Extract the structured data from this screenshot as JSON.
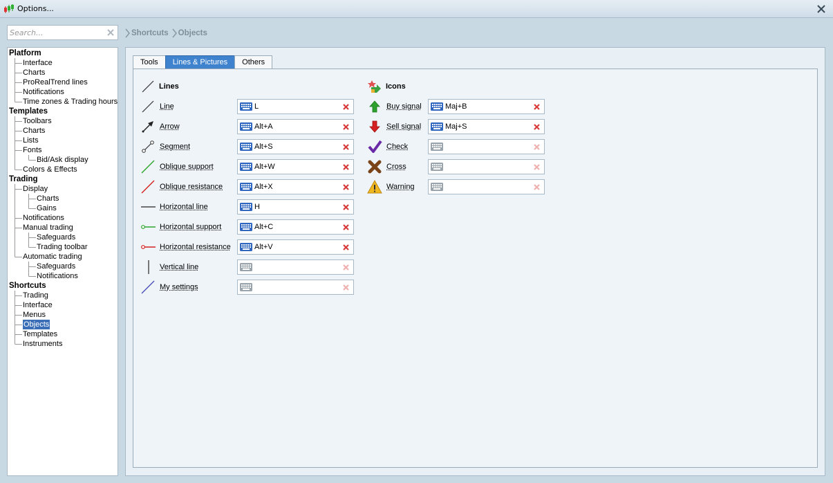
{
  "window": {
    "title": "Options..."
  },
  "search": {
    "placeholder": "Search..."
  },
  "breadcrumb": [
    "Shortcuts",
    "Objects"
  ],
  "tree": [
    {
      "label": "Platform",
      "level": 0
    },
    {
      "label": "Interface",
      "level": 1
    },
    {
      "label": "Charts",
      "level": 1
    },
    {
      "label": "ProRealTrend lines",
      "level": 1
    },
    {
      "label": "Notifications",
      "level": 1
    },
    {
      "label": "Time zones & Trading hours",
      "level": 1
    },
    {
      "label": "Templates",
      "level": 0
    },
    {
      "label": "Toolbars",
      "level": 1
    },
    {
      "label": "Charts",
      "level": 1
    },
    {
      "label": "Lists",
      "level": 1
    },
    {
      "label": "Fonts",
      "level": 1
    },
    {
      "label": "Bid/Ask display",
      "level": 2
    },
    {
      "label": "Colors & Effects",
      "level": 1
    },
    {
      "label": "Trading",
      "level": 0
    },
    {
      "label": "Display",
      "level": 1
    },
    {
      "label": "Charts",
      "level": 2
    },
    {
      "label": "Gains",
      "level": 2
    },
    {
      "label": "Notifications",
      "level": 1
    },
    {
      "label": "Manual trading",
      "level": 1
    },
    {
      "label": "Safeguards",
      "level": 2
    },
    {
      "label": "Trading toolbar",
      "level": 2
    },
    {
      "label": "Automatic trading",
      "level": 1
    },
    {
      "label": "Safeguards",
      "level": 2
    },
    {
      "label": "Notifications",
      "level": 2
    },
    {
      "label": "Shortcuts",
      "level": 0
    },
    {
      "label": "Trading",
      "level": 1
    },
    {
      "label": "Interface",
      "level": 1
    },
    {
      "label": "Menus",
      "level": 1
    },
    {
      "label": "Objects",
      "level": 1,
      "selected": true
    },
    {
      "label": "Templates",
      "level": 1
    },
    {
      "label": "Instruments",
      "level": 1
    }
  ],
  "tabs": [
    {
      "label": "Tools",
      "active": false
    },
    {
      "label": "Lines & Pictures",
      "active": true
    },
    {
      "label": "Others",
      "active": false
    }
  ],
  "lines": {
    "title": "Lines",
    "rows": [
      {
        "label": "Line",
        "shortcut": "L",
        "icon": "line-icon"
      },
      {
        "label": "Arrow",
        "shortcut": "Alt+A",
        "icon": "arrow-icon"
      },
      {
        "label": "Segment",
        "shortcut": "Alt+S",
        "icon": "segment-icon"
      },
      {
        "label": "Oblique support",
        "shortcut": "Alt+W",
        "icon": "oblique-support-icon"
      },
      {
        "label": "Oblique resistance",
        "shortcut": "Alt+X",
        "icon": "oblique-resistance-icon"
      },
      {
        "label": "Horizontal line",
        "shortcut": "H",
        "icon": "horizontal-line-icon"
      },
      {
        "label": "Horizontal support",
        "shortcut": "Alt+C",
        "icon": "horizontal-support-icon"
      },
      {
        "label": "Horizontal resistance",
        "shortcut": "Alt+V",
        "icon": "horizontal-resistance-icon"
      },
      {
        "label": "Vertical line",
        "shortcut": "",
        "icon": "vertical-line-icon"
      },
      {
        "label": "My settings",
        "shortcut": "",
        "icon": "my-settings-icon"
      }
    ]
  },
  "icons": {
    "title": "Icons",
    "rows": [
      {
        "label": "Buy signal",
        "shortcut": "Maj+B",
        "icon": "buy-signal-icon"
      },
      {
        "label": "Sell signal",
        "shortcut": "Maj+S",
        "icon": "sell-signal-icon"
      },
      {
        "label": "Check",
        "shortcut": "",
        "icon": "check-icon"
      },
      {
        "label": "Cross",
        "shortcut": "",
        "icon": "cross-icon"
      },
      {
        "label": "Warning",
        "shortcut": "",
        "icon": "warning-icon"
      }
    ]
  },
  "colors": {
    "accent": "#3f83cf",
    "selection": "#3a6fb7",
    "support": "#2aa52a",
    "resistance": "#d42020",
    "clear_active": "#d93a3a",
    "clear_inactive": "#f0b0b0"
  }
}
